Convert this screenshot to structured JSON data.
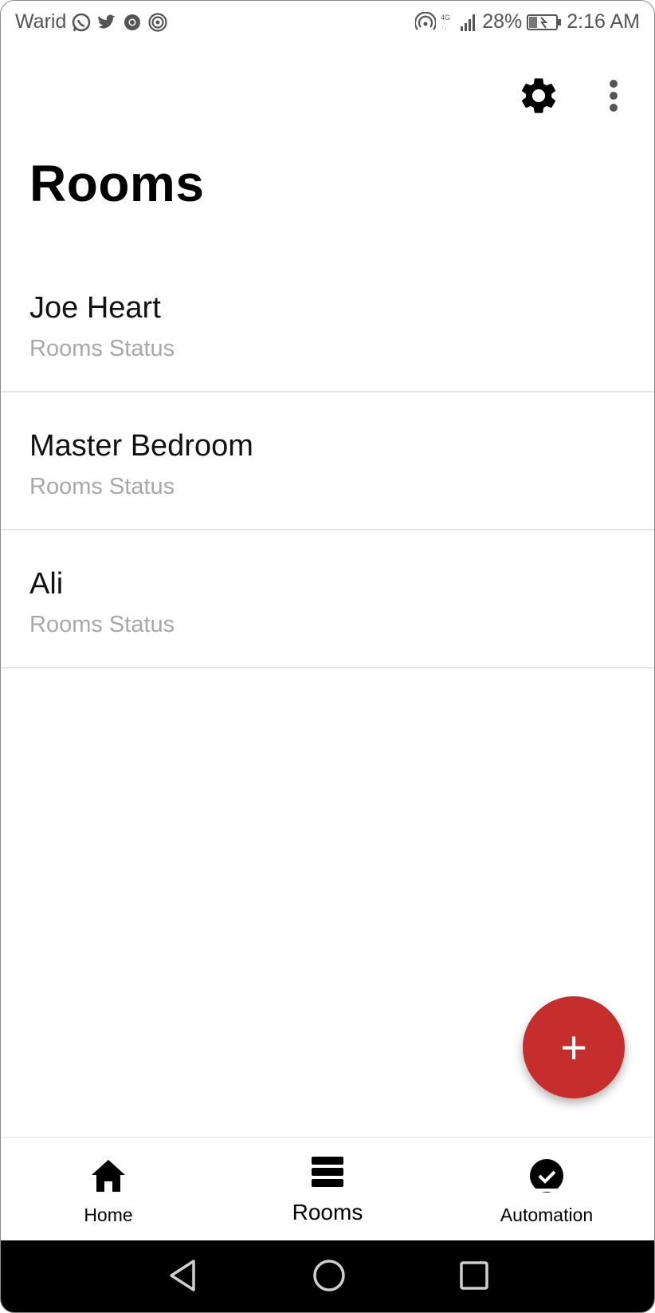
{
  "status_bar": {
    "carrier": "Warid",
    "left_icons": [
      "whatsapp-icon",
      "twitter-icon",
      "chrome-icon",
      "hotspot-icon"
    ],
    "right_icons": [
      "hotspot-icon",
      "network-4g-icon",
      "signal-icon"
    ],
    "battery_percent": "28%",
    "time": "2:16 AM"
  },
  "app_bar": {
    "icons": [
      "gear-icon",
      "more-vert-icon"
    ]
  },
  "page": {
    "title": "Rooms"
  },
  "rooms": [
    {
      "name": "Joe Heart",
      "status": "Rooms Status"
    },
    {
      "name": "Master Bedroom",
      "status": "Rooms Status"
    },
    {
      "name": "Ali",
      "status": "Rooms Status"
    }
  ],
  "fab": {
    "label": "+",
    "color": "#c62d2d"
  },
  "bottom_nav": {
    "items": [
      {
        "label": "Home",
        "icon": "home-icon"
      },
      {
        "label": "Rooms",
        "icon": "list-icon",
        "selected": true
      },
      {
        "label": "Automation",
        "icon": "check-clock-icon"
      }
    ]
  },
  "system_nav": {
    "icons": [
      "back-icon",
      "home-circle-icon",
      "recents-icon"
    ]
  }
}
